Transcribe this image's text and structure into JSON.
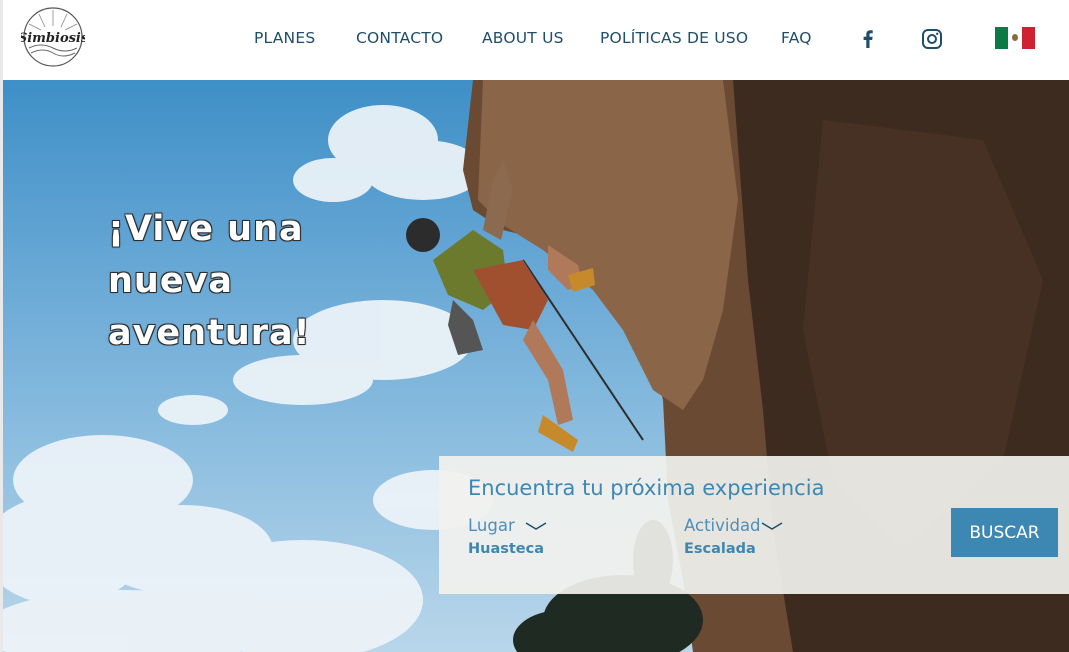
{
  "brand": {
    "logo_text": "Simbiosis"
  },
  "nav": {
    "items": [
      {
        "label": "PLANES"
      },
      {
        "label": "CONTACTO"
      },
      {
        "label": "ABOUT US"
      },
      {
        "label": "POLÍTICAS DE USO"
      },
      {
        "label": "FAQ"
      }
    ],
    "social": [
      "facebook-icon",
      "instagram-icon"
    ],
    "language_flag": "mexico-flag-icon"
  },
  "hero": {
    "headline_lines": [
      "¡Vive una",
      "nueva",
      "aventura!"
    ]
  },
  "search": {
    "title": "Encuentra tu próxima experiencia",
    "lugar_label": "Lugar",
    "lugar_value": "Huasteca",
    "actividad_label": "Actividad",
    "actividad_value": "Escalada",
    "button_label": "BUSCAR"
  },
  "colors": {
    "accent": "#3d87b3",
    "nav_text": "#1f4e6b",
    "flag_green": "#0b7a44",
    "flag_red": "#cf2230"
  }
}
